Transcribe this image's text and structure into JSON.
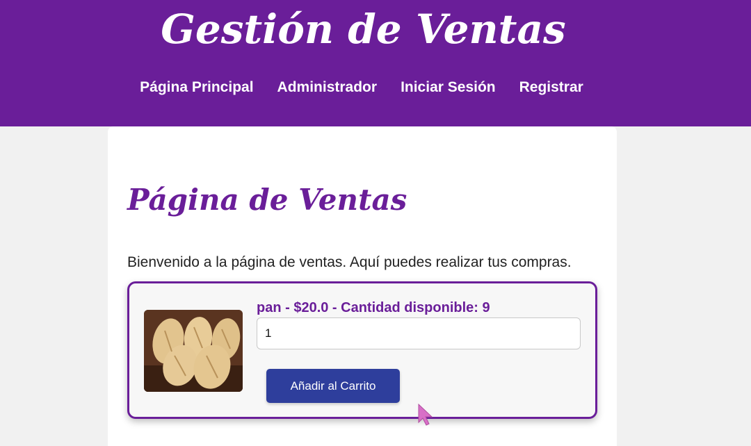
{
  "header": {
    "title": "Gestión de Ventas",
    "nav": [
      {
        "label": "Página Principal"
      },
      {
        "label": "Administrador"
      },
      {
        "label": "Iniciar Sesión"
      },
      {
        "label": "Registrar"
      }
    ]
  },
  "main": {
    "title": "Página de Ventas",
    "welcome": "Bienvenido a la página de ventas. Aquí puedes realizar tus compras.",
    "product": {
      "info": "pan - $20.0 - Cantidad disponible: 9",
      "image_icon": "bread-image",
      "quantity_value": "1",
      "add_button": "Añadir al Carrito"
    }
  },
  "colors": {
    "brand": "#6a1e99",
    "button": "#2e3e9c",
    "background": "#f1f1f1"
  }
}
